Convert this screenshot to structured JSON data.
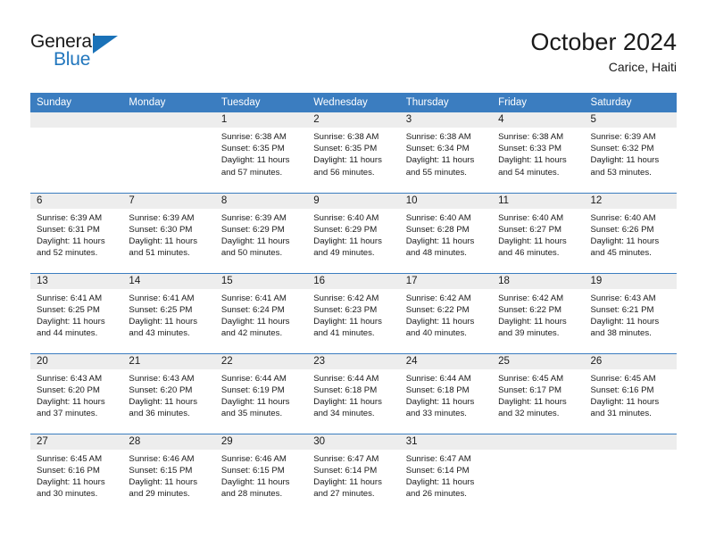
{
  "brand": {
    "name_part1": "General",
    "name_part2": "Blue",
    "triangle_color": "#1a72b8",
    "blue_color": "#2176bd"
  },
  "header": {
    "title": "October 2024",
    "subtitle": "Carice, Haiti"
  },
  "theme": {
    "header_bg": "#3b7dc0",
    "daynum_bg": "#ededed",
    "text": "#1a1a1a"
  },
  "weekdays": [
    "Sunday",
    "Monday",
    "Tuesday",
    "Wednesday",
    "Thursday",
    "Friday",
    "Saturday"
  ],
  "weeks": [
    [
      {
        "day": "",
        "empty": true
      },
      {
        "day": "",
        "empty": true
      },
      {
        "day": "1",
        "sunrise": "Sunrise: 6:38 AM",
        "sunset": "Sunset: 6:35 PM",
        "daylight1": "Daylight: 11 hours",
        "daylight2": "and 57 minutes."
      },
      {
        "day": "2",
        "sunrise": "Sunrise: 6:38 AM",
        "sunset": "Sunset: 6:35 PM",
        "daylight1": "Daylight: 11 hours",
        "daylight2": "and 56 minutes."
      },
      {
        "day": "3",
        "sunrise": "Sunrise: 6:38 AM",
        "sunset": "Sunset: 6:34 PM",
        "daylight1": "Daylight: 11 hours",
        "daylight2": "and 55 minutes."
      },
      {
        "day": "4",
        "sunrise": "Sunrise: 6:38 AM",
        "sunset": "Sunset: 6:33 PM",
        "daylight1": "Daylight: 11 hours",
        "daylight2": "and 54 minutes."
      },
      {
        "day": "5",
        "sunrise": "Sunrise: 6:39 AM",
        "sunset": "Sunset: 6:32 PM",
        "daylight1": "Daylight: 11 hours",
        "daylight2": "and 53 minutes."
      }
    ],
    [
      {
        "day": "6",
        "sunrise": "Sunrise: 6:39 AM",
        "sunset": "Sunset: 6:31 PM",
        "daylight1": "Daylight: 11 hours",
        "daylight2": "and 52 minutes."
      },
      {
        "day": "7",
        "sunrise": "Sunrise: 6:39 AM",
        "sunset": "Sunset: 6:30 PM",
        "daylight1": "Daylight: 11 hours",
        "daylight2": "and 51 minutes."
      },
      {
        "day": "8",
        "sunrise": "Sunrise: 6:39 AM",
        "sunset": "Sunset: 6:29 PM",
        "daylight1": "Daylight: 11 hours",
        "daylight2": "and 50 minutes."
      },
      {
        "day": "9",
        "sunrise": "Sunrise: 6:40 AM",
        "sunset": "Sunset: 6:29 PM",
        "daylight1": "Daylight: 11 hours",
        "daylight2": "and 49 minutes."
      },
      {
        "day": "10",
        "sunrise": "Sunrise: 6:40 AM",
        "sunset": "Sunset: 6:28 PM",
        "daylight1": "Daylight: 11 hours",
        "daylight2": "and 48 minutes."
      },
      {
        "day": "11",
        "sunrise": "Sunrise: 6:40 AM",
        "sunset": "Sunset: 6:27 PM",
        "daylight1": "Daylight: 11 hours",
        "daylight2": "and 46 minutes."
      },
      {
        "day": "12",
        "sunrise": "Sunrise: 6:40 AM",
        "sunset": "Sunset: 6:26 PM",
        "daylight1": "Daylight: 11 hours",
        "daylight2": "and 45 minutes."
      }
    ],
    [
      {
        "day": "13",
        "sunrise": "Sunrise: 6:41 AM",
        "sunset": "Sunset: 6:25 PM",
        "daylight1": "Daylight: 11 hours",
        "daylight2": "and 44 minutes."
      },
      {
        "day": "14",
        "sunrise": "Sunrise: 6:41 AM",
        "sunset": "Sunset: 6:25 PM",
        "daylight1": "Daylight: 11 hours",
        "daylight2": "and 43 minutes."
      },
      {
        "day": "15",
        "sunrise": "Sunrise: 6:41 AM",
        "sunset": "Sunset: 6:24 PM",
        "daylight1": "Daylight: 11 hours",
        "daylight2": "and 42 minutes."
      },
      {
        "day": "16",
        "sunrise": "Sunrise: 6:42 AM",
        "sunset": "Sunset: 6:23 PM",
        "daylight1": "Daylight: 11 hours",
        "daylight2": "and 41 minutes."
      },
      {
        "day": "17",
        "sunrise": "Sunrise: 6:42 AM",
        "sunset": "Sunset: 6:22 PM",
        "daylight1": "Daylight: 11 hours",
        "daylight2": "and 40 minutes."
      },
      {
        "day": "18",
        "sunrise": "Sunrise: 6:42 AM",
        "sunset": "Sunset: 6:22 PM",
        "daylight1": "Daylight: 11 hours",
        "daylight2": "and 39 minutes."
      },
      {
        "day": "19",
        "sunrise": "Sunrise: 6:43 AM",
        "sunset": "Sunset: 6:21 PM",
        "daylight1": "Daylight: 11 hours",
        "daylight2": "and 38 minutes."
      }
    ],
    [
      {
        "day": "20",
        "sunrise": "Sunrise: 6:43 AM",
        "sunset": "Sunset: 6:20 PM",
        "daylight1": "Daylight: 11 hours",
        "daylight2": "and 37 minutes."
      },
      {
        "day": "21",
        "sunrise": "Sunrise: 6:43 AM",
        "sunset": "Sunset: 6:20 PM",
        "daylight1": "Daylight: 11 hours",
        "daylight2": "and 36 minutes."
      },
      {
        "day": "22",
        "sunrise": "Sunrise: 6:44 AM",
        "sunset": "Sunset: 6:19 PM",
        "daylight1": "Daylight: 11 hours",
        "daylight2": "and 35 minutes."
      },
      {
        "day": "23",
        "sunrise": "Sunrise: 6:44 AM",
        "sunset": "Sunset: 6:18 PM",
        "daylight1": "Daylight: 11 hours",
        "daylight2": "and 34 minutes."
      },
      {
        "day": "24",
        "sunrise": "Sunrise: 6:44 AM",
        "sunset": "Sunset: 6:18 PM",
        "daylight1": "Daylight: 11 hours",
        "daylight2": "and 33 minutes."
      },
      {
        "day": "25",
        "sunrise": "Sunrise: 6:45 AM",
        "sunset": "Sunset: 6:17 PM",
        "daylight1": "Daylight: 11 hours",
        "daylight2": "and 32 minutes."
      },
      {
        "day": "26",
        "sunrise": "Sunrise: 6:45 AM",
        "sunset": "Sunset: 6:16 PM",
        "daylight1": "Daylight: 11 hours",
        "daylight2": "and 31 minutes."
      }
    ],
    [
      {
        "day": "27",
        "sunrise": "Sunrise: 6:45 AM",
        "sunset": "Sunset: 6:16 PM",
        "daylight1": "Daylight: 11 hours",
        "daylight2": "and 30 minutes."
      },
      {
        "day": "28",
        "sunrise": "Sunrise: 6:46 AM",
        "sunset": "Sunset: 6:15 PM",
        "daylight1": "Daylight: 11 hours",
        "daylight2": "and 29 minutes."
      },
      {
        "day": "29",
        "sunrise": "Sunrise: 6:46 AM",
        "sunset": "Sunset: 6:15 PM",
        "daylight1": "Daylight: 11 hours",
        "daylight2": "and 28 minutes."
      },
      {
        "day": "30",
        "sunrise": "Sunrise: 6:47 AM",
        "sunset": "Sunset: 6:14 PM",
        "daylight1": "Daylight: 11 hours",
        "daylight2": "and 27 minutes."
      },
      {
        "day": "31",
        "sunrise": "Sunrise: 6:47 AM",
        "sunset": "Sunset: 6:14 PM",
        "daylight1": "Daylight: 11 hours",
        "daylight2": "and 26 minutes."
      },
      {
        "day": "",
        "empty": true
      },
      {
        "day": "",
        "empty": true
      }
    ]
  ]
}
